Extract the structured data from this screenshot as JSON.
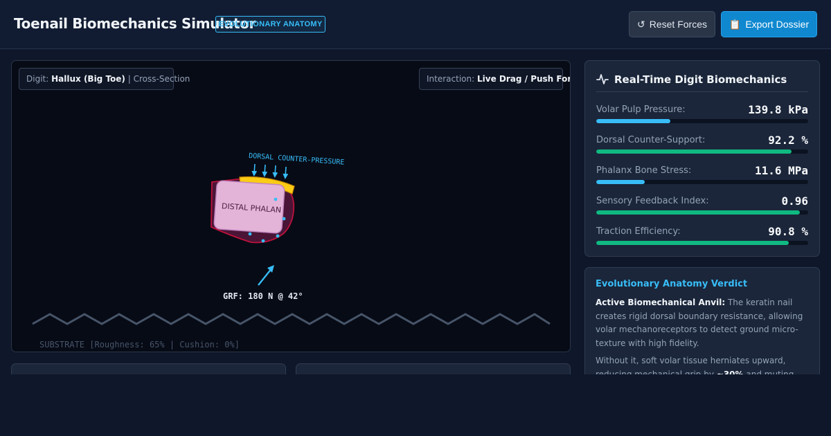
{
  "header": {
    "title": "Toenail Biomechanics Simulator",
    "badge": "EVOLUTIONARY ANATOMY",
    "reset_label": "Reset Forces",
    "export_label": "Export Dossier",
    "reset_icon": "↺",
    "export_icon": "📋"
  },
  "simulation": {
    "digit_prefix": "Digit:",
    "digit_value": "Hallux (Big Toe)",
    "digit_suffix": "| Cross-Section",
    "interaction_prefix": "Interaction:",
    "interaction_value": "Live Drag / Push Force",
    "dorsal_label": "DORSAL COUNTER-PRESSURE",
    "phalanx_label": "DISTAL PHALAN",
    "grf_label": "GRF: 180 N @ 42°",
    "substrate_label": "SUBSTRATE [Roughness: 65% | Cushion: 0%]"
  },
  "metrics": {
    "title": "Real-Time Digit Biomechanics",
    "items": [
      {
        "label": "Volar Pulp Pressure:",
        "value": "139.8 kPa",
        "fill": 0.35,
        "color": "#38bdf8"
      },
      {
        "label": "Dorsal Counter-Support:",
        "value": "92.2 %",
        "fill": 0.922,
        "color": "#10b981"
      },
      {
        "label": "Phalanx Bone Stress:",
        "value": "11.6 MPa",
        "fill": 0.23,
        "color": "#38bdf8"
      },
      {
        "label": "Sensory Feedback Index:",
        "value": "0.96",
        "fill": 0.96,
        "color": "#10b981"
      },
      {
        "label": "Traction Efficiency:",
        "value": "90.8 %",
        "fill": 0.908,
        "color": "#10b981"
      }
    ]
  },
  "verdict": {
    "title": "Evolutionary Anatomy Verdict",
    "p1_bold": "Active Biomechanical Anvil:",
    "p1_text": " The keratin nail creates rigid dorsal boundary resistance, allowing volar mechanoreceptors to detect ground micro-texture with high fidelity.",
    "p2_text_a": "Without it, soft volar tissue herniates upward, reducing mechanical grip by ",
    "p2_bold": "~30%",
    "p2_text_b": " and muting tactile"
  },
  "colors": {
    "accent": "#38bdf8",
    "success": "#10b981",
    "nail": "#facc15",
    "tissue_outline": "#be123c",
    "bone": "#e4b4d8"
  }
}
